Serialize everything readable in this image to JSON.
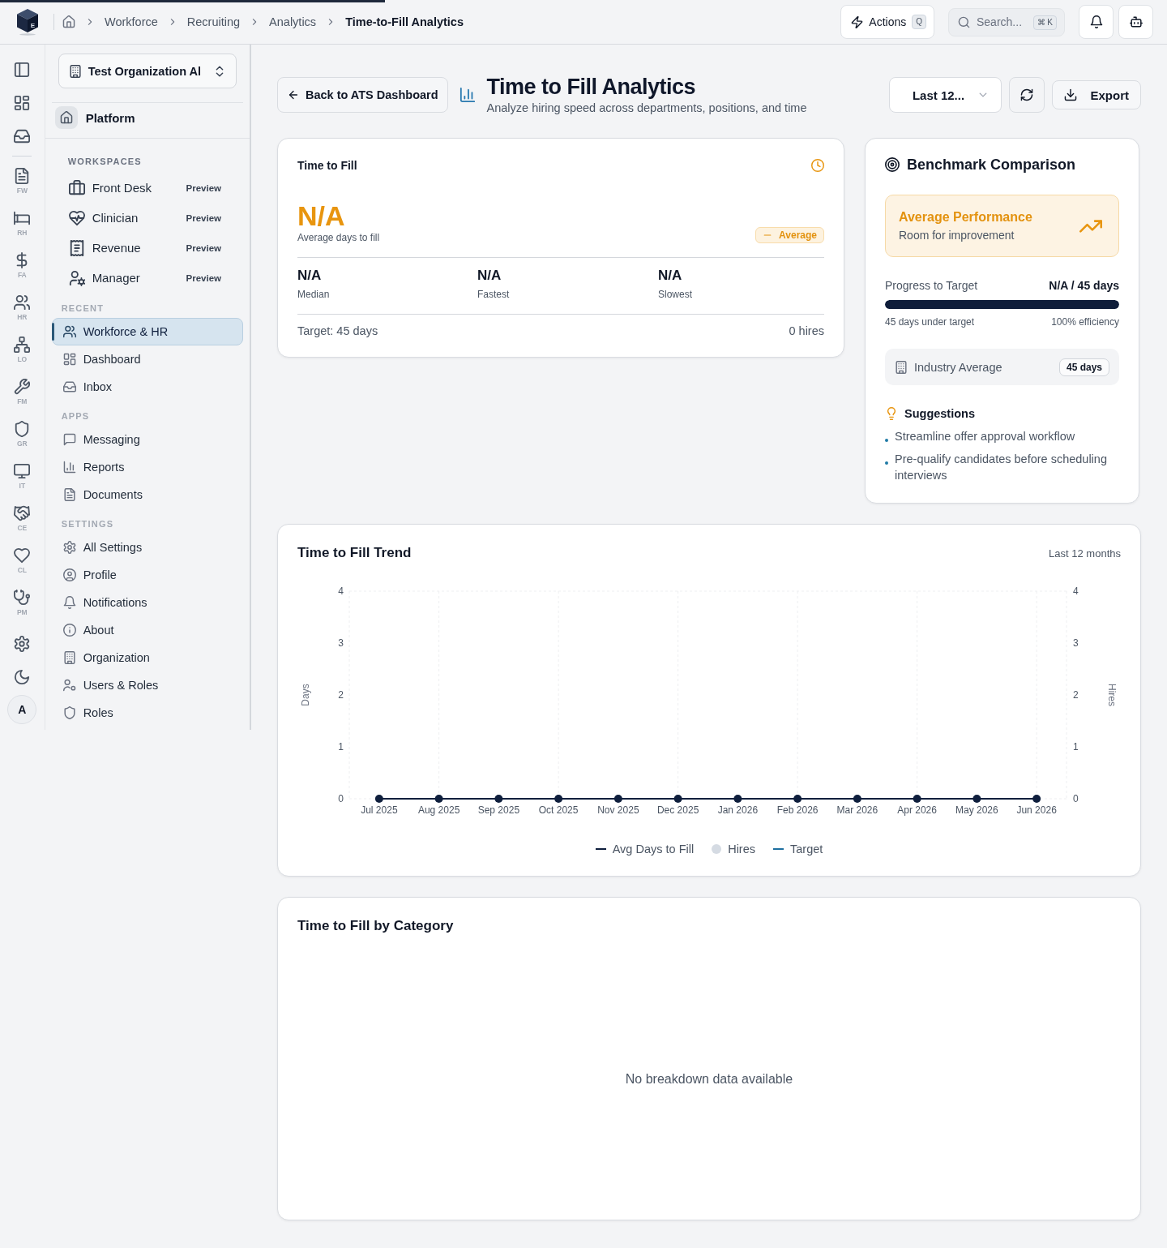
{
  "top_bar": {
    "loading": {
      "level": 0.33
    },
    "logo_mark": "E",
    "breadcrumbs": [
      {
        "label": "Workforce",
        "current": false
      },
      {
        "label": "Recruiting",
        "current": false
      },
      {
        "label": "Analytics",
        "current": false
      },
      {
        "label": "Time-to-Fill Analytics",
        "current": true
      }
    ],
    "actions": {
      "label": "Actions",
      "shortcut": "Q"
    },
    "search": {
      "placeholder": "Search...",
      "shortcut": "⌘ K"
    }
  },
  "rail": {
    "modules": [
      {
        "label": "FW",
        "selected": false
      },
      {
        "label": "RH",
        "selected": false
      },
      {
        "label": "FA",
        "selected": false
      },
      {
        "label": "HR",
        "selected": false
      },
      {
        "label": "LO",
        "selected": false
      },
      {
        "label": "FM",
        "selected": false
      },
      {
        "label": "GR",
        "selected": false
      },
      {
        "label": "IT",
        "selected": false
      },
      {
        "label": "CE",
        "selected": false
      },
      {
        "label": "CL",
        "selected": false
      },
      {
        "label": "PM",
        "selected": false
      }
    ],
    "avatar": "A"
  },
  "sidebar": {
    "organization": "Test Organization Al",
    "platform": "Platform",
    "sections": [
      {
        "title": "WORKSPACES",
        "kind": "workspaces",
        "items": [
          {
            "label": "Front Desk",
            "badge": "Preview",
            "selected": false
          },
          {
            "label": "Clinician",
            "badge": "Preview",
            "selected": false
          },
          {
            "label": "Revenue",
            "badge": "Preview",
            "selected": false
          },
          {
            "label": "Manager",
            "badge": "Preview",
            "selected": false
          }
        ]
      },
      {
        "title": "RECENT",
        "kind": "links",
        "items": [
          {
            "label": "Workforce & HR",
            "selected": true
          },
          {
            "label": "Dashboard",
            "selected": false
          },
          {
            "label": "Inbox",
            "selected": false
          }
        ]
      },
      {
        "title": "APPS",
        "kind": "links",
        "items": [
          {
            "label": "Messaging",
            "selected": false
          },
          {
            "label": "Reports",
            "selected": false
          },
          {
            "label": "Documents",
            "selected": false
          }
        ]
      },
      {
        "title": "SETTINGS",
        "kind": "links",
        "items": [
          {
            "label": "All Settings",
            "selected": false
          },
          {
            "label": "Profile",
            "selected": false
          },
          {
            "label": "Notifications",
            "selected": false
          },
          {
            "label": "About",
            "selected": false
          },
          {
            "label": "Organization",
            "selected": false
          },
          {
            "label": "Users & Roles",
            "selected": false
          },
          {
            "label": "Roles",
            "selected": false
          }
        ]
      }
    ]
  },
  "page_header": {
    "back_button": "Back to ATS Dashboard",
    "title": "Time to Fill Analytics",
    "subtitle": "Analyze hiring speed across departments, positions, and time",
    "period_select": "Last 12...",
    "export_button": "Export"
  },
  "time_to_fill": {
    "title": "Time to Fill",
    "value": "N/A",
    "value_label": "Average days to fill",
    "rating": "Average",
    "stats": [
      {
        "value": "N/A",
        "label": "Median"
      },
      {
        "value": "N/A",
        "label": "Fastest"
      },
      {
        "value": "N/A",
        "label": "Slowest"
      }
    ],
    "target": "Target: 45 days",
    "hires": "0 hires"
  },
  "benchmark": {
    "title": "Benchmark Comparison",
    "performance": {
      "title": "Average Performance",
      "subtitle": "Room for improvement"
    },
    "progress": {
      "label": "Progress to Target",
      "reading": "N/A / 45 days",
      "level": 1,
      "left_note": "45 days under target",
      "right_note": "100% efficiency"
    },
    "industry": {
      "label": "Industry Average",
      "value": "45 days"
    },
    "suggestions": {
      "title": "Suggestions",
      "items": [
        "Streamline offer approval workflow",
        "Pre-qualify candidates before scheduling interviews"
      ]
    }
  },
  "trend": {
    "title": "Time to Fill Trend",
    "period": "Last 12 months",
    "chart_data": {
      "type": "line",
      "categories": [
        "Jul 2025",
        "Aug 2025",
        "Sep 2025",
        "Oct 2025",
        "Nov 2025",
        "Dec 2025",
        "Jan 2026",
        "Feb 2026",
        "Mar 2026",
        "Apr 2026",
        "May 2026",
        "Jun 2026"
      ],
      "ylabel": "Days",
      "ylim": [
        0,
        4
      ],
      "yticks": [
        0,
        1,
        2,
        3,
        4
      ],
      "grid": true,
      "series": [
        {
          "name": "Avg Days to Fill",
          "type": "line",
          "marker": "circle",
          "color": "#0f1f3d",
          "values": [
            0,
            0,
            0,
            0,
            0,
            0,
            0,
            0,
            0,
            0,
            0,
            0
          ]
        },
        {
          "name": "Hires",
          "type": "bar",
          "color": "#d5dbe3",
          "values": [
            0,
            0,
            0,
            0,
            0,
            0,
            0,
            0,
            0,
            0,
            0,
            0
          ]
        },
        {
          "name": "Target",
          "type": "line",
          "color": "#1e6fa0",
          "values": [
            null,
            null,
            null,
            null,
            null,
            null,
            null,
            null,
            null,
            null,
            null,
            null
          ]
        }
      ]
    },
    "secondary_axis": {
      "label": "Hires",
      "ticks": [
        "4",
        "3",
        "2",
        "1",
        "0"
      ]
    }
  },
  "by_category": {
    "title": "Time to Fill by Category",
    "empty": "No breakdown data available"
  }
}
